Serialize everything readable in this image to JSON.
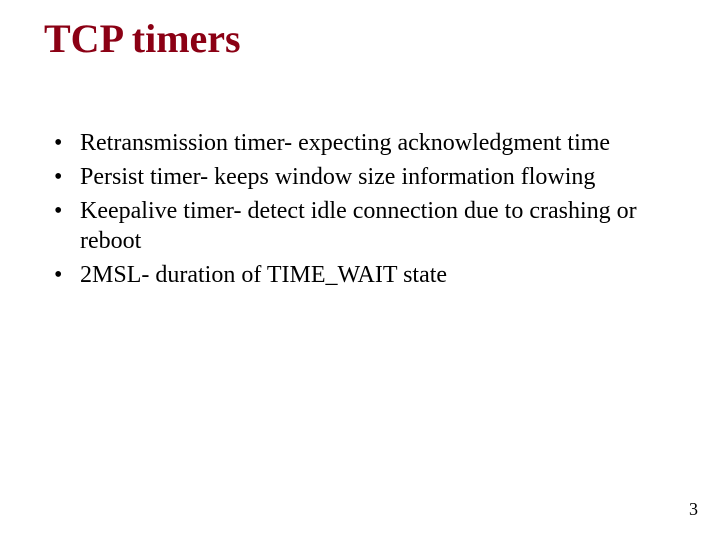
{
  "title": "TCP timers",
  "bullets": [
    "Retransmission timer- expecting acknowledgment time",
    "Persist timer- keeps window size information flowing",
    "Keepalive timer- detect idle connection due to crashing or reboot",
    "2MSL- duration of TIME_WAIT state"
  ],
  "page_number": "3"
}
